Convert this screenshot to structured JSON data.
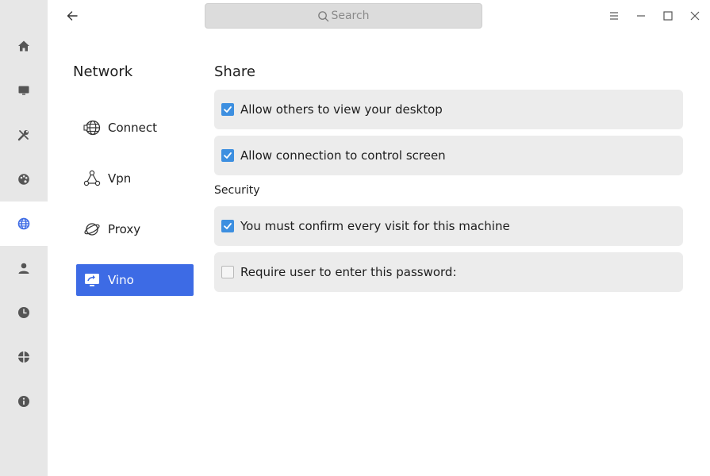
{
  "rail": {
    "items": [
      {
        "icon": "home-icon"
      },
      {
        "icon": "display-icon"
      },
      {
        "icon": "tools-icon"
      },
      {
        "icon": "palette-icon"
      },
      {
        "icon": "globe-icon",
        "active": true
      },
      {
        "icon": "user-icon"
      },
      {
        "icon": "clock-icon"
      },
      {
        "icon": "crosshair-icon"
      },
      {
        "icon": "info-icon"
      }
    ]
  },
  "titlebar": {
    "search_placeholder": "Search",
    "buttons": [
      "menu-icon",
      "minimize-icon",
      "maximize-icon",
      "close-icon"
    ]
  },
  "sidebar": {
    "title": "Network",
    "items": [
      {
        "label": "Connect",
        "icon": "globe-network-icon"
      },
      {
        "label": "Vpn",
        "icon": "vpn-nodes-icon"
      },
      {
        "label": "Proxy",
        "icon": "planet-icon"
      },
      {
        "label": "Vino",
        "icon": "remote-desktop-icon",
        "active": true
      }
    ]
  },
  "main": {
    "share_title": "Share",
    "security_title": "Security",
    "options": [
      {
        "label": "Allow others to view your desktop",
        "checked": true
      },
      {
        "label": "Allow connection to control screen",
        "checked": true
      },
      {
        "label": "You must confirm every visit for this machine",
        "checked": true
      },
      {
        "label": "Require user to enter this password:",
        "checked": false
      }
    ]
  },
  "colors": {
    "accent": "#3d6be5",
    "checkbox": "#3d8fe0",
    "rail_bg": "#e7e7e7",
    "row_bg": "#ececec"
  }
}
